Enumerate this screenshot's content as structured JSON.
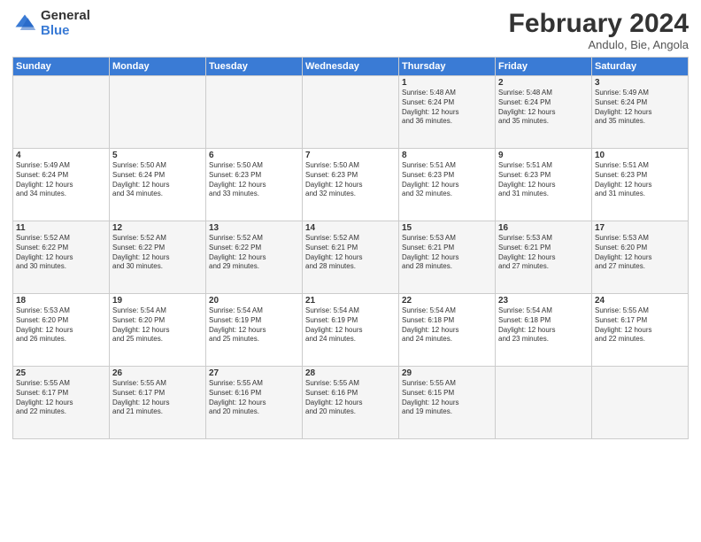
{
  "logo": {
    "general": "General",
    "blue": "Blue"
  },
  "title": "February 2024",
  "subtitle": "Andulo, Bie, Angola",
  "days_of_week": [
    "Sunday",
    "Monday",
    "Tuesday",
    "Wednesday",
    "Thursday",
    "Friday",
    "Saturday"
  ],
  "weeks": [
    [
      {
        "day": "",
        "detail": ""
      },
      {
        "day": "",
        "detail": ""
      },
      {
        "day": "",
        "detail": ""
      },
      {
        "day": "",
        "detail": ""
      },
      {
        "day": "1",
        "detail": "Sunrise: 5:48 AM\nSunset: 6:24 PM\nDaylight: 12 hours\nand 36 minutes."
      },
      {
        "day": "2",
        "detail": "Sunrise: 5:48 AM\nSunset: 6:24 PM\nDaylight: 12 hours\nand 35 minutes."
      },
      {
        "day": "3",
        "detail": "Sunrise: 5:49 AM\nSunset: 6:24 PM\nDaylight: 12 hours\nand 35 minutes."
      }
    ],
    [
      {
        "day": "4",
        "detail": "Sunrise: 5:49 AM\nSunset: 6:24 PM\nDaylight: 12 hours\nand 34 minutes."
      },
      {
        "day": "5",
        "detail": "Sunrise: 5:50 AM\nSunset: 6:24 PM\nDaylight: 12 hours\nand 34 minutes."
      },
      {
        "day": "6",
        "detail": "Sunrise: 5:50 AM\nSunset: 6:23 PM\nDaylight: 12 hours\nand 33 minutes."
      },
      {
        "day": "7",
        "detail": "Sunrise: 5:50 AM\nSunset: 6:23 PM\nDaylight: 12 hours\nand 32 minutes."
      },
      {
        "day": "8",
        "detail": "Sunrise: 5:51 AM\nSunset: 6:23 PM\nDaylight: 12 hours\nand 32 minutes."
      },
      {
        "day": "9",
        "detail": "Sunrise: 5:51 AM\nSunset: 6:23 PM\nDaylight: 12 hours\nand 31 minutes."
      },
      {
        "day": "10",
        "detail": "Sunrise: 5:51 AM\nSunset: 6:23 PM\nDaylight: 12 hours\nand 31 minutes."
      }
    ],
    [
      {
        "day": "11",
        "detail": "Sunrise: 5:52 AM\nSunset: 6:22 PM\nDaylight: 12 hours\nand 30 minutes."
      },
      {
        "day": "12",
        "detail": "Sunrise: 5:52 AM\nSunset: 6:22 PM\nDaylight: 12 hours\nand 30 minutes."
      },
      {
        "day": "13",
        "detail": "Sunrise: 5:52 AM\nSunset: 6:22 PM\nDaylight: 12 hours\nand 29 minutes."
      },
      {
        "day": "14",
        "detail": "Sunrise: 5:52 AM\nSunset: 6:21 PM\nDaylight: 12 hours\nand 28 minutes."
      },
      {
        "day": "15",
        "detail": "Sunrise: 5:53 AM\nSunset: 6:21 PM\nDaylight: 12 hours\nand 28 minutes."
      },
      {
        "day": "16",
        "detail": "Sunrise: 5:53 AM\nSunset: 6:21 PM\nDaylight: 12 hours\nand 27 minutes."
      },
      {
        "day": "17",
        "detail": "Sunrise: 5:53 AM\nSunset: 6:20 PM\nDaylight: 12 hours\nand 27 minutes."
      }
    ],
    [
      {
        "day": "18",
        "detail": "Sunrise: 5:53 AM\nSunset: 6:20 PM\nDaylight: 12 hours\nand 26 minutes."
      },
      {
        "day": "19",
        "detail": "Sunrise: 5:54 AM\nSunset: 6:20 PM\nDaylight: 12 hours\nand 25 minutes."
      },
      {
        "day": "20",
        "detail": "Sunrise: 5:54 AM\nSunset: 6:19 PM\nDaylight: 12 hours\nand 25 minutes."
      },
      {
        "day": "21",
        "detail": "Sunrise: 5:54 AM\nSunset: 6:19 PM\nDaylight: 12 hours\nand 24 minutes."
      },
      {
        "day": "22",
        "detail": "Sunrise: 5:54 AM\nSunset: 6:18 PM\nDaylight: 12 hours\nand 24 minutes."
      },
      {
        "day": "23",
        "detail": "Sunrise: 5:54 AM\nSunset: 6:18 PM\nDaylight: 12 hours\nand 23 minutes."
      },
      {
        "day": "24",
        "detail": "Sunrise: 5:55 AM\nSunset: 6:17 PM\nDaylight: 12 hours\nand 22 minutes."
      }
    ],
    [
      {
        "day": "25",
        "detail": "Sunrise: 5:55 AM\nSunset: 6:17 PM\nDaylight: 12 hours\nand 22 minutes."
      },
      {
        "day": "26",
        "detail": "Sunrise: 5:55 AM\nSunset: 6:17 PM\nDaylight: 12 hours\nand 21 minutes."
      },
      {
        "day": "27",
        "detail": "Sunrise: 5:55 AM\nSunset: 6:16 PM\nDaylight: 12 hours\nand 20 minutes."
      },
      {
        "day": "28",
        "detail": "Sunrise: 5:55 AM\nSunset: 6:16 PM\nDaylight: 12 hours\nand 20 minutes."
      },
      {
        "day": "29",
        "detail": "Sunrise: 5:55 AM\nSunset: 6:15 PM\nDaylight: 12 hours\nand 19 minutes."
      },
      {
        "day": "",
        "detail": ""
      },
      {
        "day": "",
        "detail": ""
      }
    ]
  ]
}
